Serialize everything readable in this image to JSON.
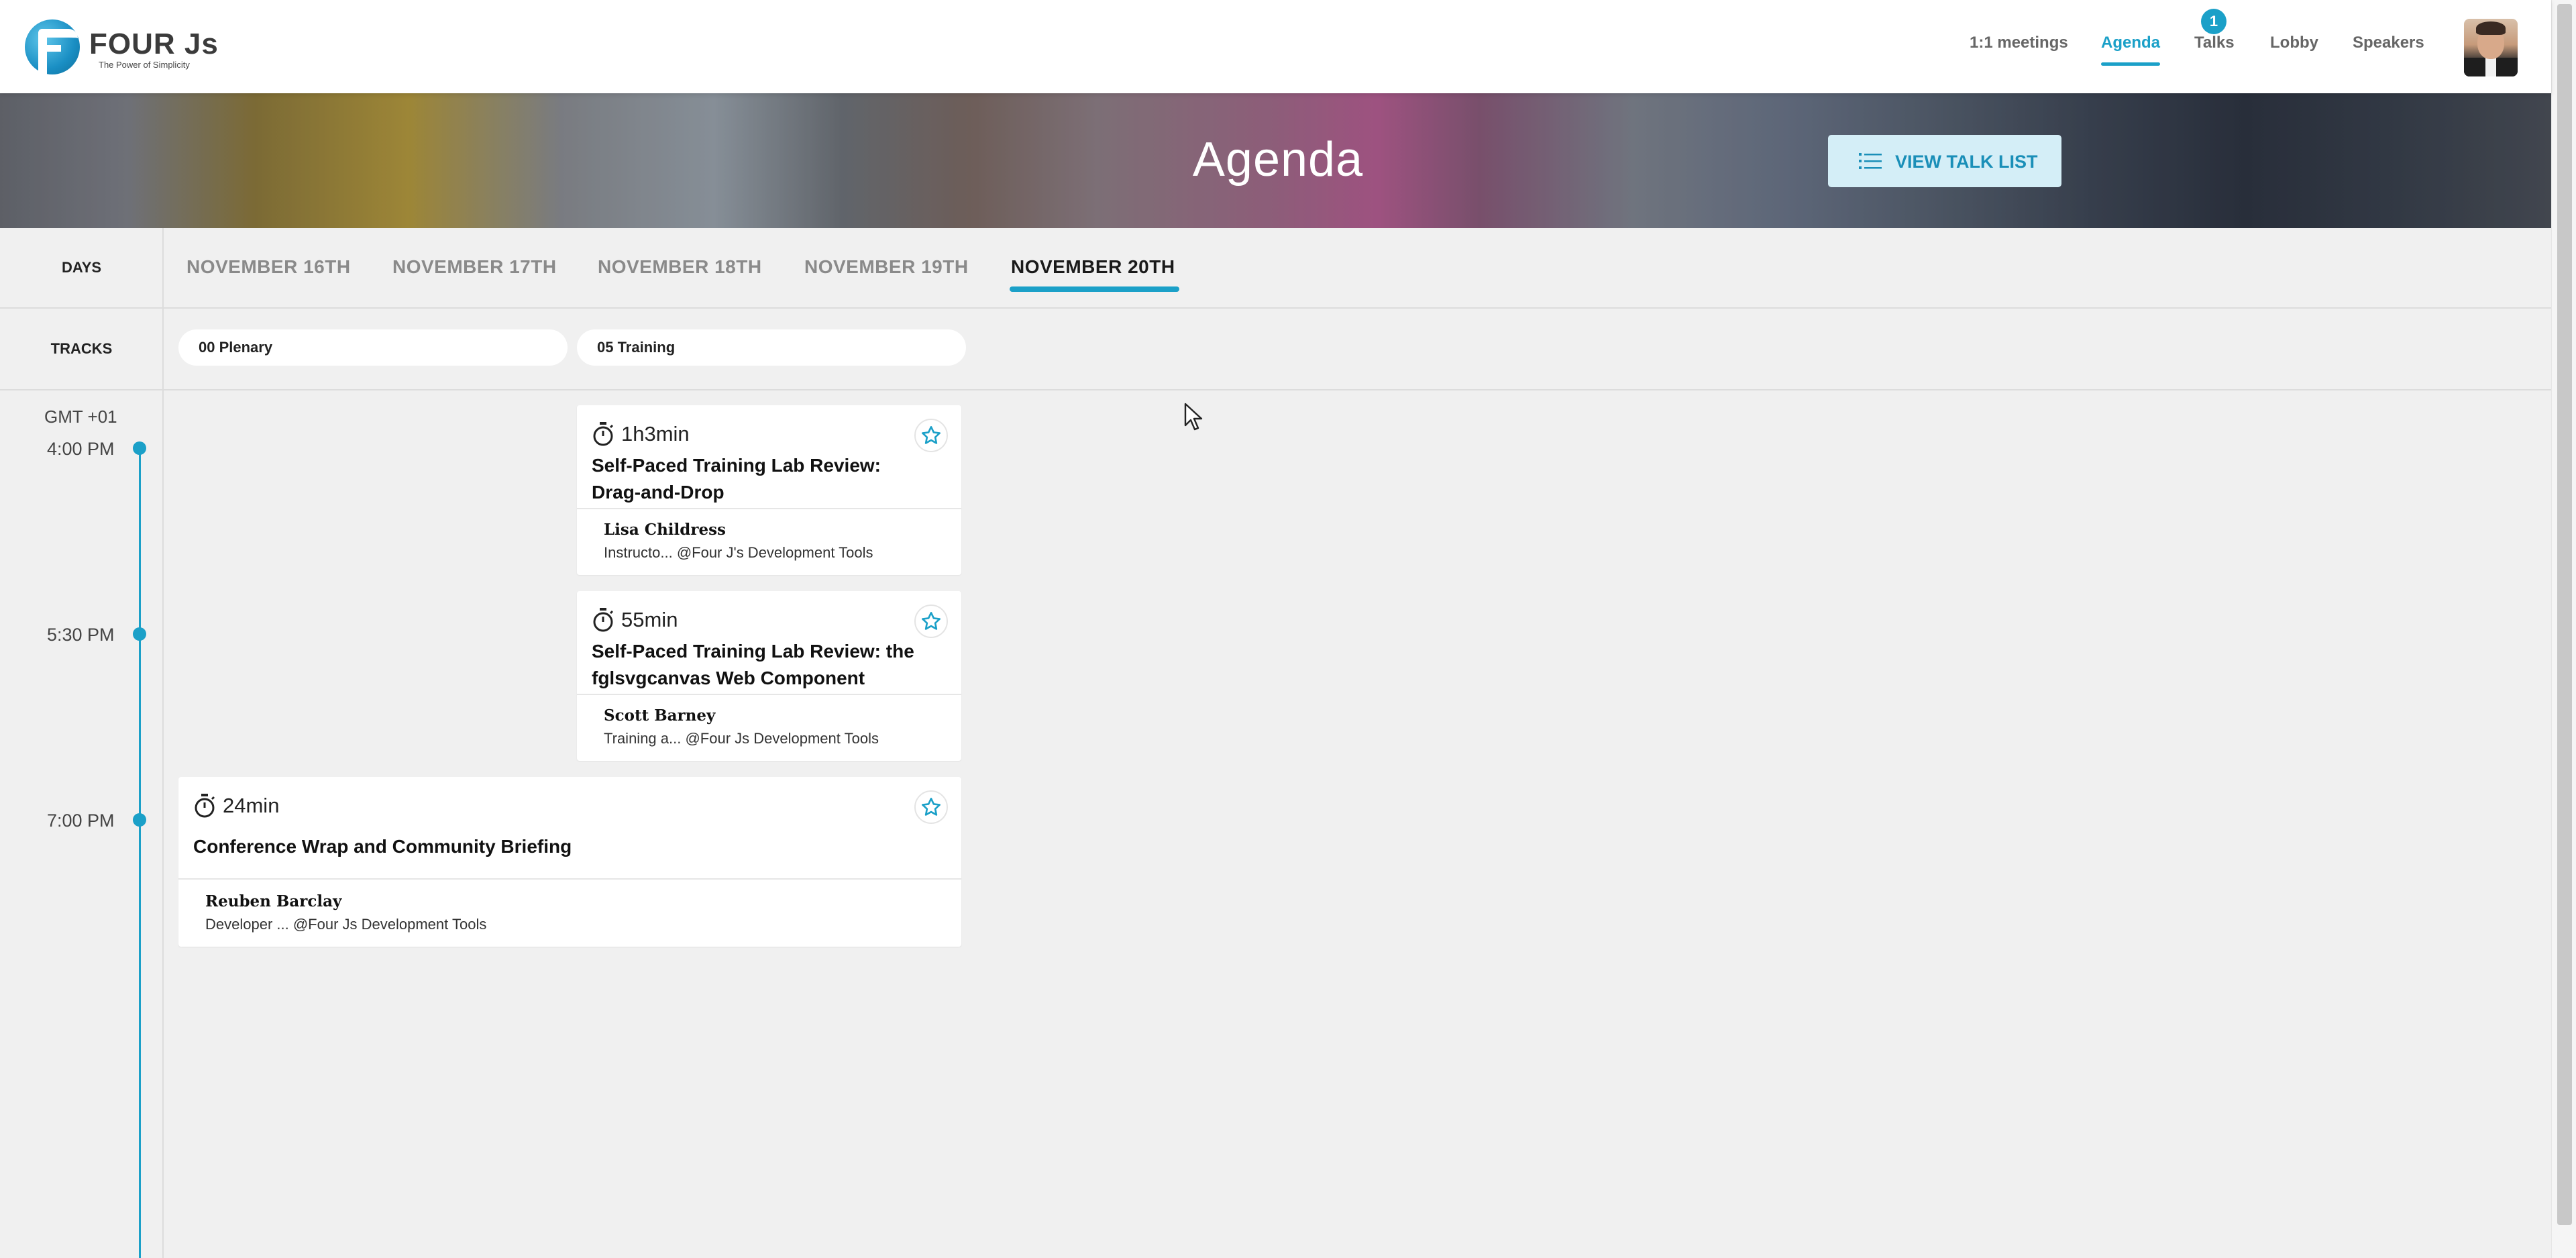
{
  "header": {
    "logo_text": "FOUR Js",
    "logo_tagline": "The Power of Simplicity",
    "nav": [
      {
        "label": "1:1 meetings",
        "active": false
      },
      {
        "label": "Agenda",
        "active": true
      },
      {
        "label": "Talks",
        "active": false,
        "badge": "1"
      },
      {
        "label": "Lobby",
        "active": false
      },
      {
        "label": "Speakers",
        "active": false
      }
    ],
    "avatar_icon": "user-avatar"
  },
  "banner": {
    "title": "Agenda",
    "view_button_label": "VIEW TALK LIST",
    "view_button_icon": "list-icon"
  },
  "days": {
    "label": "DAYS",
    "tabs": [
      "NOVEMBER 16TH",
      "NOVEMBER 17TH",
      "NOVEMBER 18TH",
      "NOVEMBER 19TH",
      "NOVEMBER 20TH"
    ],
    "active_index": 4
  },
  "tracks": {
    "label": "TRACKS",
    "items": [
      "00 Plenary",
      "05 Training"
    ]
  },
  "timeline": {
    "timezone": "GMT +01",
    "times": [
      "4:00 PM",
      "5:30 PM",
      "7:00 PM"
    ]
  },
  "talks": [
    {
      "duration": "1h3min",
      "title": "Self-Paced Training Lab Review: Drag-and-Drop",
      "speaker": "Lisa Childress",
      "role": "Instructo... @Four J's Development Tools",
      "track": "05 Training"
    },
    {
      "duration": "55min",
      "title": "Self-Paced Training Lab Review: the fglsvgcanvas Web Component",
      "speaker": "Scott Barney",
      "role": "Training a... @Four Js Development Tools",
      "track": "05 Training"
    },
    {
      "duration": "24min",
      "title": "Conference Wrap and Community Briefing",
      "speaker": "Reuben Barclay",
      "role": "Developer ... @Four Js Development Tools",
      "track": "00 Plenary"
    }
  ],
  "colors": {
    "accent": "#1ba0c8",
    "background": "#f0f0f0",
    "button_bg": "#d4eef7"
  }
}
